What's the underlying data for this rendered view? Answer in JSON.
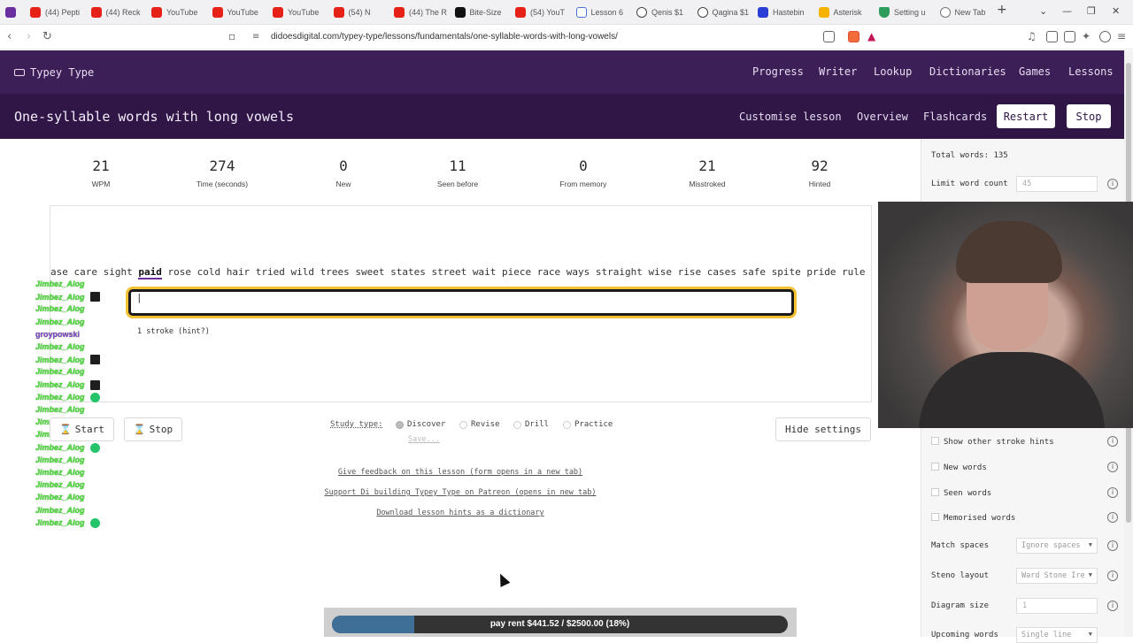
{
  "browser": {
    "tabs": [
      {
        "label": "(44) Pepti",
        "icon": "youtube-icon"
      },
      {
        "label": "(44) Reck",
        "icon": "youtube-icon"
      },
      {
        "label": "YouTube",
        "icon": "youtube-icon"
      },
      {
        "label": "YouTube",
        "icon": "youtube-icon"
      },
      {
        "label": "YouTube",
        "icon": "youtube-icon"
      },
      {
        "label": "(54) N",
        "icon": "youtube-icon"
      },
      {
        "label": "(44) The R",
        "icon": "youtube-icon"
      },
      {
        "label": "Bite-Size",
        "icon": "x-icon"
      },
      {
        "label": "(54) YouT",
        "icon": "youtube-icon"
      },
      {
        "label": "Lesson 6",
        "icon": "doc-icon"
      },
      {
        "label": "Qenis $1",
        "icon": "globe-icon"
      },
      {
        "label": "Qagina $1",
        "icon": "globe-icon"
      },
      {
        "label": "Hastebin",
        "icon": "hastebin-icon"
      },
      {
        "label": "Asterisk",
        "icon": "asterisk-icon"
      },
      {
        "label": "Setting u",
        "icon": "shield-icon"
      },
      {
        "label": "New Tab",
        "icon": "newtab-icon"
      }
    ],
    "new_tab": "+",
    "url": "didoesdigital.com/typey-type/lessons/fundamentals/one-syllable-words-with-long-vowels/"
  },
  "site": {
    "brand": "Typey Type",
    "nav": [
      "Progress",
      "Writer",
      "Lookup",
      "Dictionaries",
      "Games",
      "Lessons"
    ]
  },
  "lesson": {
    "title": "One-syllable words with long vowels",
    "actions": [
      "Customise lesson",
      "Overview",
      "Flashcards"
    ],
    "restart": "Restart",
    "stop": "Stop"
  },
  "stats": [
    {
      "value": "21",
      "label": "WPM"
    },
    {
      "value": "274",
      "label": "Time (seconds)"
    },
    {
      "value": "0",
      "label": "New"
    },
    {
      "value": "11",
      "label": "Seen before"
    },
    {
      "value": "0",
      "label": "From memory"
    },
    {
      "value": "21",
      "label": "Misstroked"
    },
    {
      "value": "92",
      "label": "Hinted"
    }
  ],
  "material": {
    "before": "ase care sight",
    "current": "paid",
    "after": "rose cold hair tried wild trees sweet states street wait piece race ways straight wise rise cases safe spite pride rule s"
  },
  "input": {
    "value": "|"
  },
  "hint": "1 stroke (hint?)",
  "chat": [
    {
      "name": "Jimbez_Alog",
      "emote": ""
    },
    {
      "name": "Jimbez_Alog",
      "emote": "dark"
    },
    {
      "name": "Jimbez_Alog",
      "emote": ""
    },
    {
      "name": "Jimbez_Alog",
      "emote": ""
    },
    {
      "name": "groypowski",
      "emote": "",
      "purple": true
    },
    {
      "name": "Jimbez_Alog",
      "emote": ""
    },
    {
      "name": "Jimbez_Alog",
      "emote": "dark"
    },
    {
      "name": "Jimbez_Alog",
      "emote": ""
    },
    {
      "name": "Jimbez_Alog",
      "emote": "dark"
    },
    {
      "name": "Jimbez_Alog",
      "emote": "green"
    },
    {
      "name": "Jimbez_Alog",
      "emote": ""
    },
    {
      "name": "Jimbez_Alog",
      "emote": ""
    },
    {
      "name": "Jimbez_Alog",
      "emote": ""
    },
    {
      "name": "Jimbez_Alog",
      "emote": "green"
    },
    {
      "name": "Jimbez_Alog",
      "emote": ""
    },
    {
      "name": "Jimbez_Alog",
      "emote": ""
    },
    {
      "name": "Jimbez_Alog",
      "emote": ""
    },
    {
      "name": "Jimbez_Alog",
      "emote": ""
    },
    {
      "name": "Jimbez_Alog",
      "emote": ""
    },
    {
      "name": "Jimbez_Alog",
      "emote": "green"
    }
  ],
  "controls": {
    "start": "Start",
    "stop": "Stop",
    "study_type_label": "Study type:",
    "study_types": [
      "Discover",
      "Revise",
      "Drill",
      "Practice"
    ],
    "selected_study_type": "Discover",
    "save": "Save...",
    "hide_settings": "Hide settings"
  },
  "footer_links": [
    "Give feedback on this lesson (form opens in a new tab)",
    "Support Di building Typey Type on Patreon (opens in new tab)",
    "Download lesson hints as a dictionary"
  ],
  "settings": {
    "total_words": "Total words: 135",
    "limit_word_count_label": "Limit word count",
    "limit_word_count_value": "45",
    "show_other_stroke_hints": "Show other stroke hints",
    "new_words": "New words",
    "seen_words": "Seen words",
    "memorised_words": "Memorised words",
    "match_spaces_label": "Match spaces",
    "match_spaces_value": "Ignore spaces",
    "steno_layout_label": "Steno layout",
    "steno_layout_value": "Ward Stone Ire",
    "diagram_size_label": "Diagram size",
    "diagram_size_value": "1",
    "upcoming_words_label": "Upcoming words",
    "upcoming_words_value": "Single line"
  },
  "goal": {
    "text": "pay rent $441.52 / $2500.00 (18%)",
    "progress": 0.18
  }
}
